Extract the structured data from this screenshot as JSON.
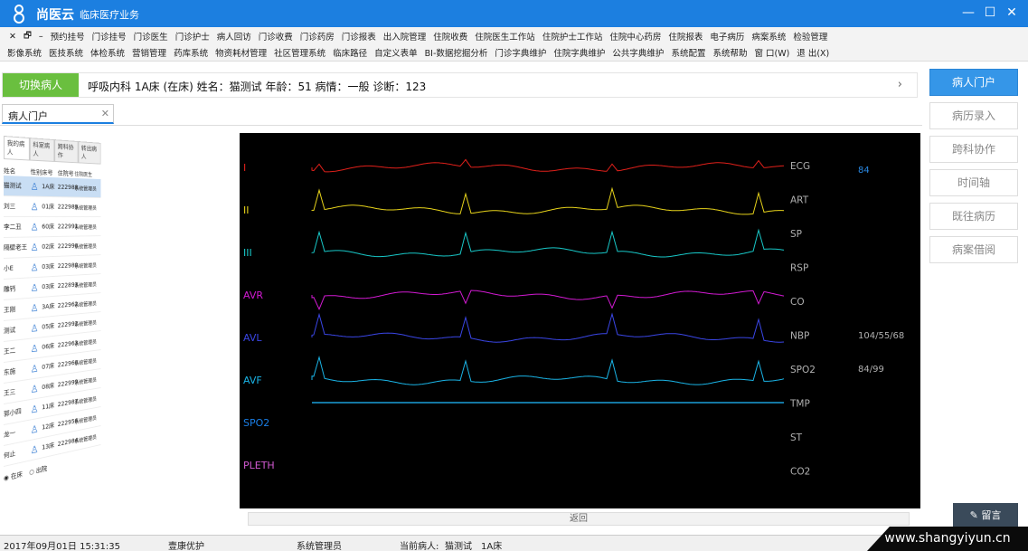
{
  "window": {
    "brand": "尚医云",
    "subtitle": "临床医疗业务",
    "brand_color": "#1c7fe0",
    "controls": {
      "minimize": "—",
      "maximize": "☐",
      "close": "✕"
    }
  },
  "menu": {
    "row1_prefix": [
      "✕",
      "🗗",
      "–"
    ],
    "row1": [
      "预约挂号",
      "门诊挂号",
      "门诊医生",
      "门诊护士",
      "病人回访",
      "门诊收费",
      "门诊药房",
      "门诊报表",
      "出入院管理",
      "住院收费",
      "住院医生工作站",
      "住院护士工作站",
      "住院中心药房",
      "住院报表",
      "电子病历",
      "病案系统",
      "检验管理"
    ],
    "row2": [
      "影像系统",
      "医技系统",
      "体检系统",
      "营销管理",
      "药库系统",
      "物资耗材管理",
      "社区管理系统",
      "临床路径",
      "自定义表单",
      "BI-数据挖掘分析",
      "门诊字典维护",
      "住院字典维护",
      "公共字典维护",
      "系统配置",
      "系统帮助",
      "窗 口(W)",
      "退 出(X)"
    ]
  },
  "patient_bar": {
    "switch_label": "切换病人",
    "info": "呼吸内科 1A床 (在床) 姓名：猫测试 年龄：51 病情：一般 诊断：123",
    "expand_icon": "›"
  },
  "tab": {
    "label": "病人门户",
    "close": "✕"
  },
  "patient_list": {
    "tabs": [
      "我的病人",
      "科室病人",
      "跨科协作",
      "转出病人"
    ],
    "headers": {
      "name": "姓名",
      "gender": "性别",
      "bed": "床号",
      "no": "住院号",
      "doctor": "住院医生"
    },
    "rows": [
      {
        "name": "猫测试",
        "bed": "1A床",
        "no": "222988",
        "doctor": "系统管理员"
      },
      {
        "name": "刘三",
        "bed": "01床",
        "no": "222989",
        "doctor": "系统管理员"
      },
      {
        "name": "李二丑",
        "bed": "60床",
        "no": "222991",
        "doctor": "系统管理员"
      },
      {
        "name": "隔壁老王",
        "bed": "02床",
        "no": "222990",
        "doctor": "系统管理员"
      },
      {
        "name": "小E",
        "bed": "03床",
        "no": "222980",
        "doctor": "系统管理员"
      },
      {
        "name": "雕钙",
        "bed": "03床",
        "no": "222893",
        "doctor": "系统管理员"
      },
      {
        "name": "王刚",
        "bed": "3A床",
        "no": "222962",
        "doctor": "系统管理员"
      },
      {
        "name": "测试",
        "bed": "05床",
        "no": "222992",
        "doctor": "系统管理员"
      },
      {
        "name": "王二",
        "bed": "06床",
        "no": "222963",
        "doctor": "系统管理员"
      },
      {
        "name": "东施",
        "bed": "07床",
        "no": "222960",
        "doctor": "系统管理员"
      },
      {
        "name": "王三",
        "bed": "08床",
        "no": "222999",
        "doctor": "系统管理员"
      },
      {
        "name": "郭小四",
        "bed": "11床",
        "no": "222987",
        "doctor": "系统管理员"
      },
      {
        "name": "龙一",
        "bed": "12床",
        "no": "222956",
        "doctor": "系统管理员"
      },
      {
        "name": "何止",
        "bed": "13床",
        "no": "222984",
        "doctor": "系统管理员"
      }
    ],
    "filter_in": "在床",
    "filter_out": "出院"
  },
  "monitor": {
    "leads": [
      {
        "label": "I",
        "color": "#e0201a"
      },
      {
        "label": "II",
        "color": "#e6d21a"
      },
      {
        "label": "III",
        "color": "#18c8c8"
      },
      {
        "label": "AVR",
        "color": "#d21ad2"
      },
      {
        "label": "AVL",
        "color": "#3a46e6"
      },
      {
        "label": "AVF",
        "color": "#1ab4e6"
      },
      {
        "label": "SPO2",
        "color": "#1a7ee6"
      },
      {
        "label": "PLETH",
        "color": "#d25ad2"
      }
    ],
    "params": [
      "ECG",
      "ART",
      "SP",
      "RSP",
      "CO",
      "NBP",
      "SPO2",
      "TMP",
      "ST",
      "CO2"
    ],
    "values": {
      "ecg": "84",
      "nbp": "104/55/68",
      "spo2": "84/99"
    },
    "back_label": "返回"
  },
  "right_nav": {
    "items": [
      "病人门户",
      "病历录入",
      "跨科协作",
      "时间轴",
      "既往病历",
      "病案借阅"
    ],
    "active_color": "#3596e8"
  },
  "message_button": "留言",
  "status": {
    "datetime": "2017年09月01日 15:31:35",
    "org": "壹康优护",
    "user": "系统管理员",
    "current_label": "当前病人:",
    "current_patient": "猫测试",
    "current_bed": "1A床"
  },
  "watermark": "www.shangyiyun.cn"
}
